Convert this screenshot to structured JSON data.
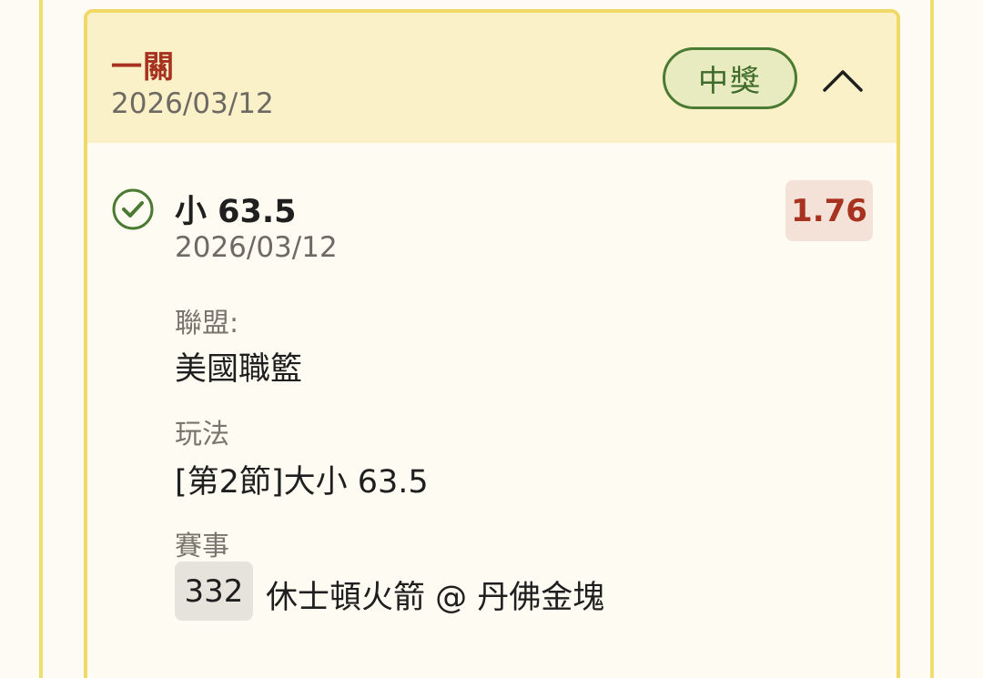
{
  "bet": {
    "type_label": "一關",
    "date": "2026/03/12",
    "status_label": "中獎",
    "collapse_icon": "chevron-up-icon"
  },
  "selection": {
    "status_icon": "check-circle-icon",
    "name": "小 63.5",
    "date": "2026/03/12",
    "odds": "1.76",
    "league_label": "聯盟:",
    "league_value": "美國職籃",
    "market_label": "玩法",
    "market_value": "[第2節]大小 63.5",
    "event_label": "賽事",
    "event_number": "332",
    "event_name": "休士頓火箭 @ 丹佛金塊"
  },
  "colors": {
    "accent_red": "#a6321f",
    "win_green": "#3d6a2a",
    "card_border": "#f0d966",
    "header_bg": "#fbf1c8"
  }
}
